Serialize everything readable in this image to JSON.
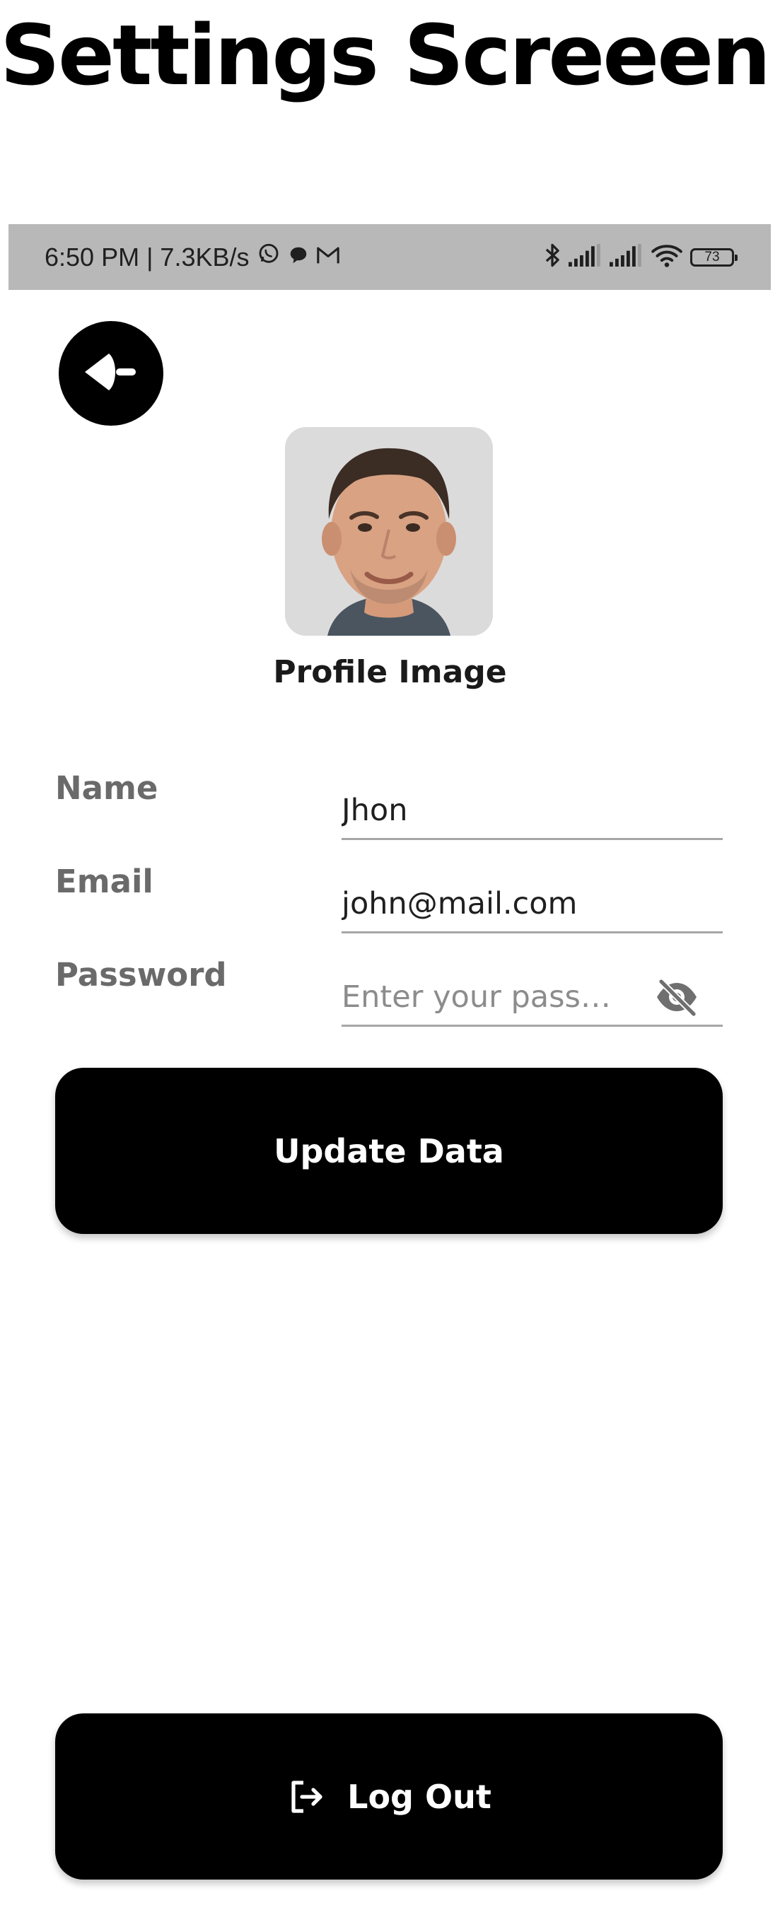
{
  "page": {
    "title": "Settings Screeen"
  },
  "status_bar": {
    "time_and_speed": "6:50 PM | 7.3KB/s",
    "left_icons": [
      "whatsapp-icon",
      "chat-bubble-icon",
      "gmail-icon"
    ],
    "right_icons": [
      "bluetooth-icon",
      "signal-icon",
      "signal-icon",
      "wifi-icon",
      "battery-icon"
    ],
    "battery_level": "73",
    "background": "#b8b8b8"
  },
  "back_button": {
    "icon": "back-arrow-icon"
  },
  "profile": {
    "image_label": "Profile Image"
  },
  "form": {
    "name": {
      "label": "Name",
      "value": "Jhon"
    },
    "email": {
      "label": "Email",
      "value": "john@mail.com"
    },
    "password": {
      "label": "Password",
      "value": "",
      "placeholder": "Enter your passw...",
      "toggle_icon": "eye-off-icon"
    }
  },
  "update_button": {
    "label": "Update Data"
  },
  "logout_button": {
    "label": "Log Out",
    "icon": "logout-icon"
  },
  "colors": {
    "primary": "#000000",
    "label_gray": "#6a6a6a",
    "underline": "#a6a6a6"
  }
}
